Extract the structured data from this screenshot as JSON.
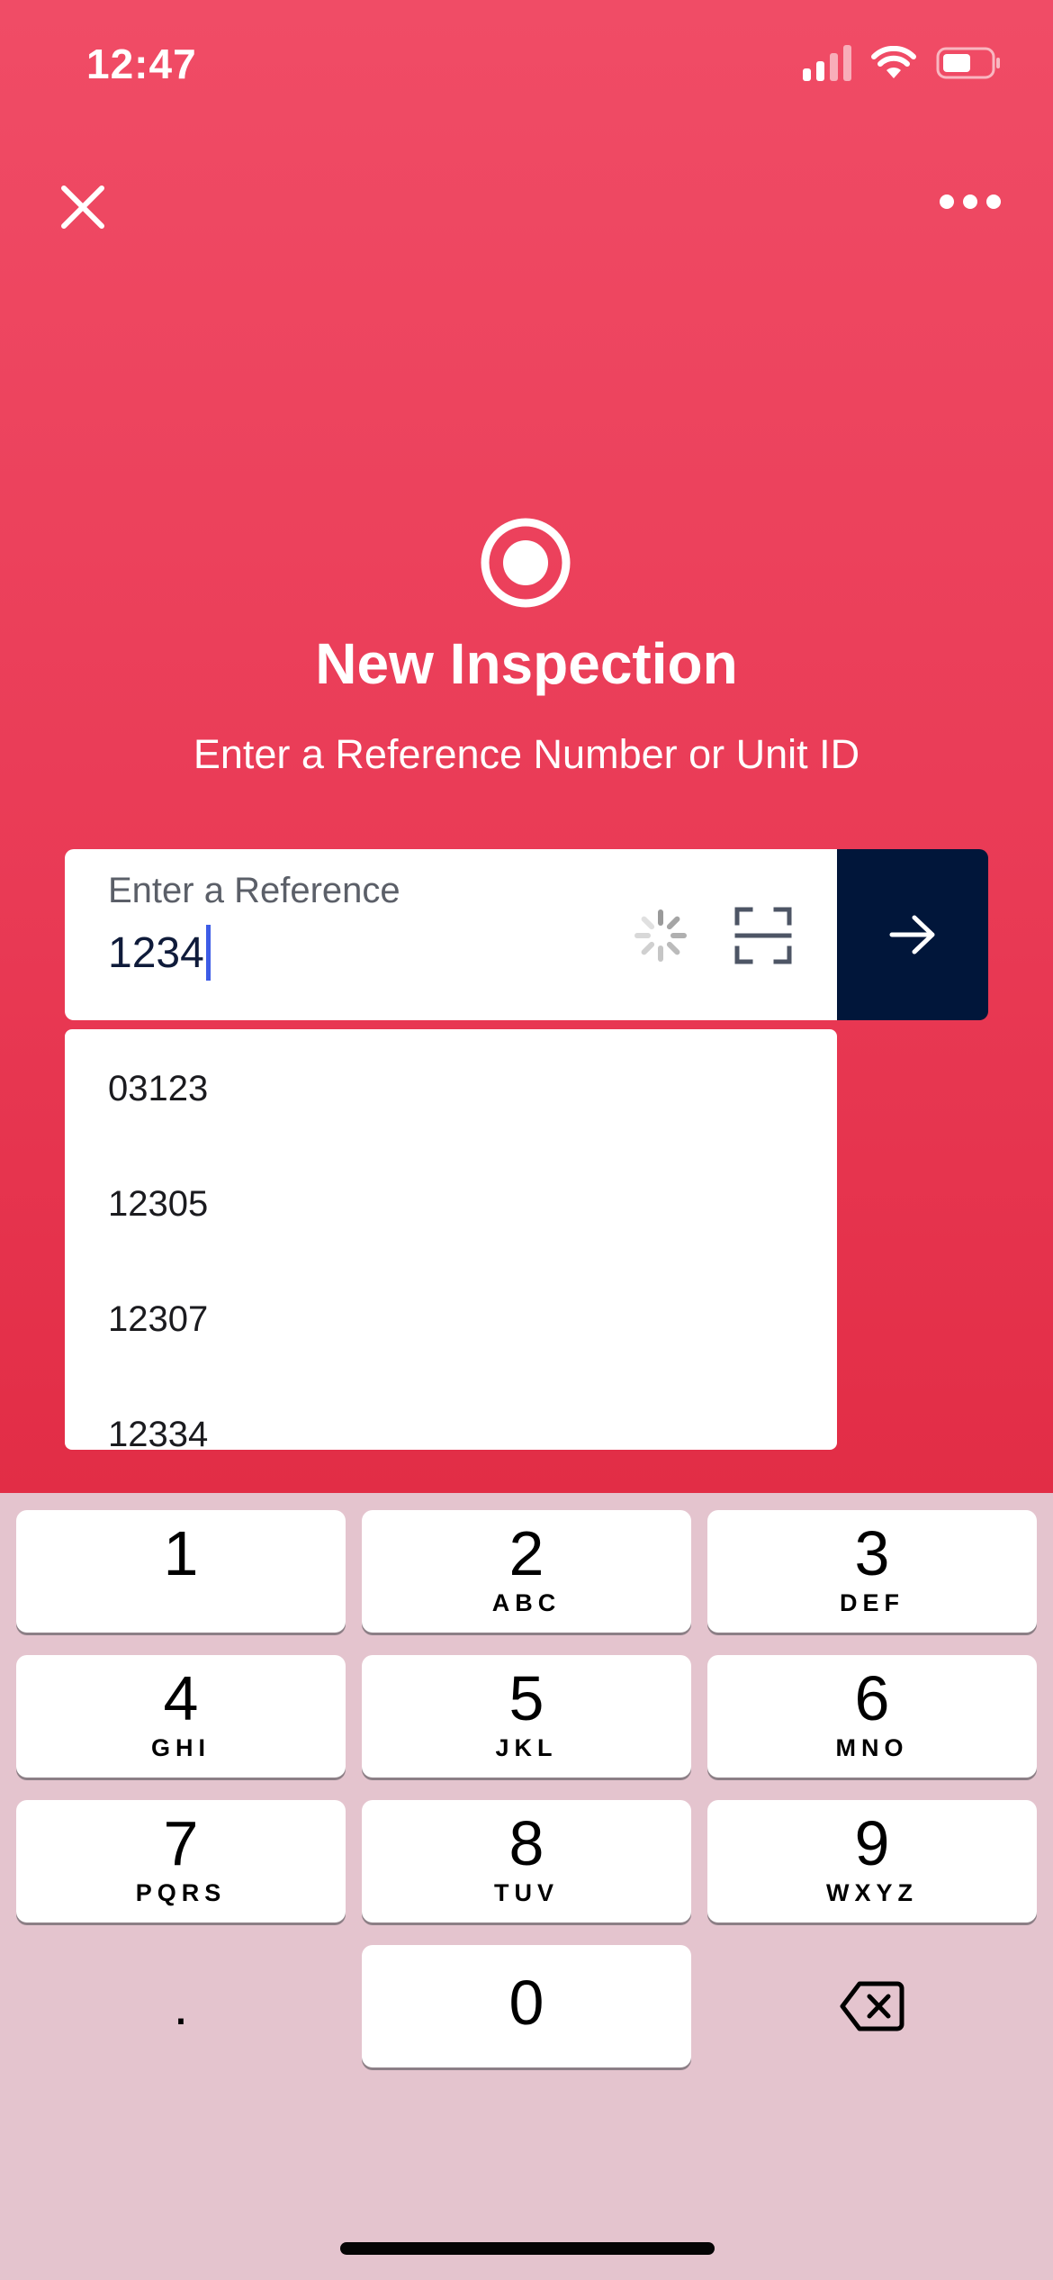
{
  "status_bar": {
    "time": "12:47",
    "icons": [
      "cellular-signal-icon",
      "wifi-icon",
      "battery-icon"
    ]
  },
  "nav": {
    "close_icon": "close-icon",
    "more_icon": "more-horizontal-icon"
  },
  "hero": {
    "icon": "record-circle-icon",
    "title": "New Inspection",
    "subtitle": "Enter a Reference Number or Unit ID"
  },
  "reference_input": {
    "label": "Enter a Reference",
    "value": "1234",
    "loading_icon": "loading-spinner-icon",
    "scan_icon": "scan-icon",
    "submit_icon": "arrow-right-icon"
  },
  "suggestions": [
    "03123",
    "12305",
    "12307",
    "12334"
  ],
  "keypad": {
    "keys": [
      {
        "digit": "1",
        "letters": ""
      },
      {
        "digit": "2",
        "letters": "ABC"
      },
      {
        "digit": "3",
        "letters": "DEF"
      },
      {
        "digit": "4",
        "letters": "GHI"
      },
      {
        "digit": "5",
        "letters": "JKL"
      },
      {
        "digit": "6",
        "letters": "MNO"
      },
      {
        "digit": "7",
        "letters": "PQRS"
      },
      {
        "digit": "8",
        "letters": "TUV"
      },
      {
        "digit": "9",
        "letters": "WXYZ"
      },
      {
        "digit": "0",
        "letters": ""
      }
    ],
    "decimal": ".",
    "delete_icon": "backspace-icon"
  },
  "colors": {
    "header_gradient_top": "#f04c66",
    "header_gradient_bottom": "#e22d46",
    "submit_button": "#01163a",
    "caret": "#3d5ce6",
    "keyboard_background": "#e4c4ce"
  }
}
